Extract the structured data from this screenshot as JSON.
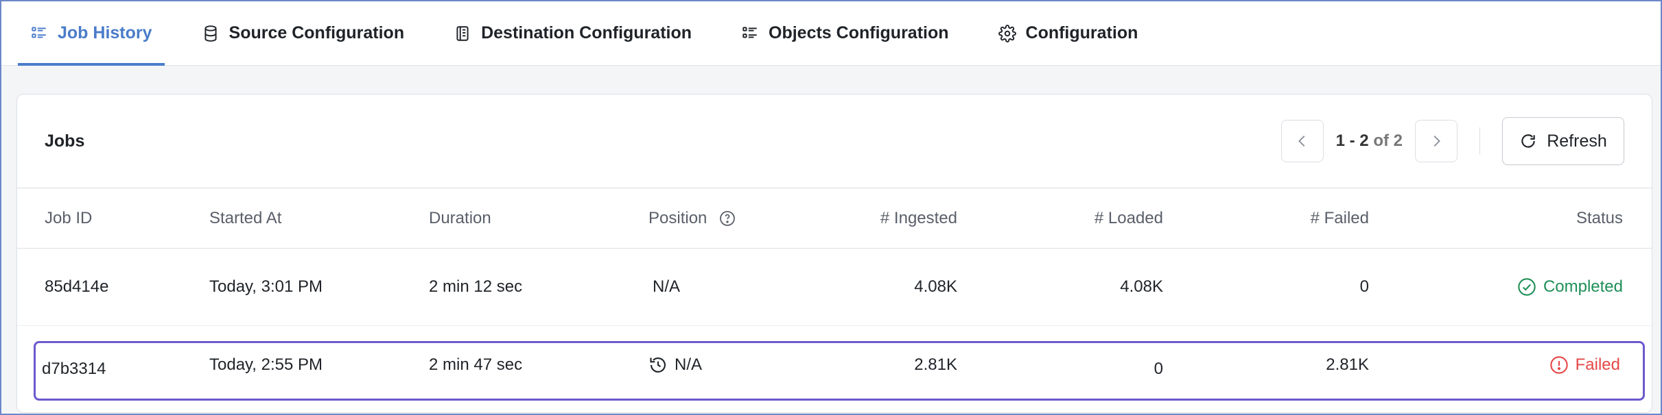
{
  "tabs": [
    {
      "label": "Job History",
      "icon": "list-icon",
      "active": true
    },
    {
      "label": "Source Configuration",
      "icon": "database-icon"
    },
    {
      "label": "Destination Configuration",
      "icon": "archive-icon"
    },
    {
      "label": "Objects Configuration",
      "icon": "list-icon"
    },
    {
      "label": "Configuration",
      "icon": "gear-icon"
    }
  ],
  "card": {
    "title": "Jobs",
    "pagination": {
      "range": "1 - 2",
      "of": "of 2"
    },
    "refresh_label": "Refresh"
  },
  "table": {
    "headers": [
      "Job ID",
      "Started At",
      "Duration",
      "Position",
      "# Ingested",
      "# Loaded",
      "# Failed",
      "Status"
    ],
    "rows": [
      {
        "job_id": "85d414e",
        "started_at": "Today, 3:01 PM",
        "duration": "2 min 12 sec",
        "position": "N/A",
        "ingested": "4.08K",
        "loaded": "4.08K",
        "failed": "0",
        "status": "Completed"
      },
      {
        "job_id": "d7b3314",
        "started_at": "Today, 2:55 PM",
        "duration": "2 min 47 sec",
        "position": "N/A",
        "ingested": "2.81K",
        "loaded": "0",
        "failed": "2.81K",
        "status": "Failed"
      }
    ]
  },
  "colors": {
    "accent": "#4a7cc9",
    "success": "#1f8f57",
    "error": "#e54848",
    "selection": "#6a5acd"
  }
}
